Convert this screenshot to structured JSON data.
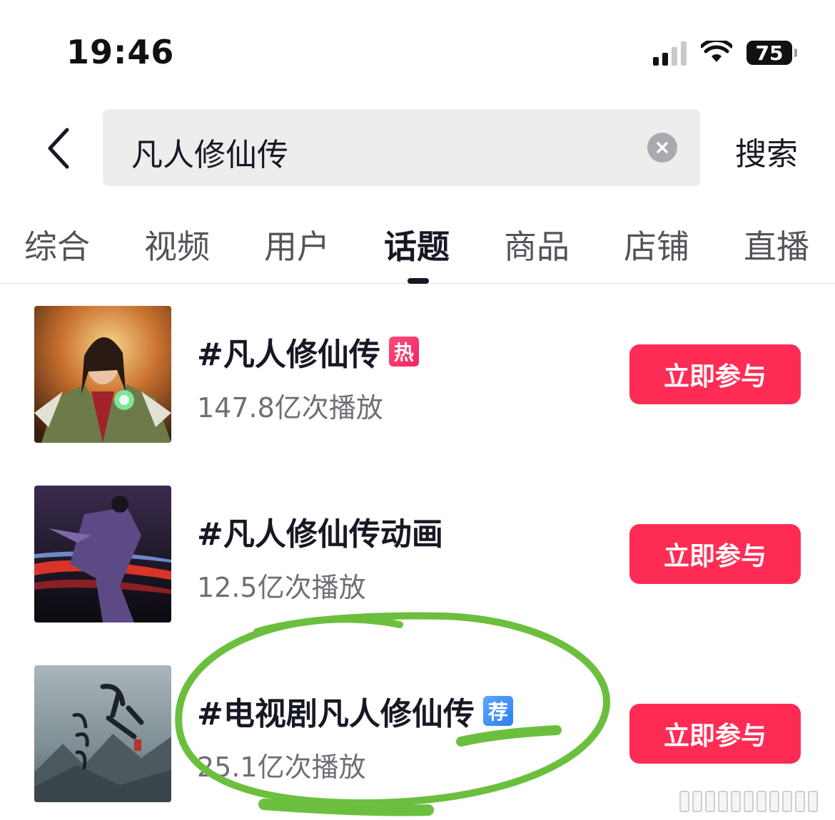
{
  "status_bar": {
    "time": "19:46",
    "battery": "75",
    "icons": [
      "cellular-signal-icon",
      "wifi-icon",
      "battery-icon"
    ]
  },
  "search": {
    "query": "凡人修仙传",
    "submit_label": "搜索",
    "icons": [
      "back-arrow-icon",
      "clear-icon"
    ]
  },
  "tabs": [
    {
      "label": "综合",
      "active": false
    },
    {
      "label": "视频",
      "active": false
    },
    {
      "label": "用户",
      "active": false
    },
    {
      "label": "话题",
      "active": true
    },
    {
      "label": "商品",
      "active": false
    },
    {
      "label": "店铺",
      "active": false
    },
    {
      "label": "直播",
      "active": false
    }
  ],
  "results": [
    {
      "title": "#凡人修仙传",
      "badge": "热",
      "badge_type": "hot",
      "plays": "147.8亿次播放",
      "button": "立即参与"
    },
    {
      "title": "#凡人修仙传动画",
      "badge": "",
      "badge_type": "",
      "plays": "12.5亿次播放",
      "button": "立即参与"
    },
    {
      "title": "#电视剧凡人修仙传",
      "badge": "荐",
      "badge_type": "recommended",
      "plays": "25.1亿次播放",
      "button": "立即参与"
    }
  ],
  "colors": {
    "primary_button": "#fe2c55",
    "hot_badge": "#f2245e",
    "recommended_badge": "#2e7ff0",
    "annotation_stroke": "#6cbf3e",
    "search_background": "#ededee"
  }
}
